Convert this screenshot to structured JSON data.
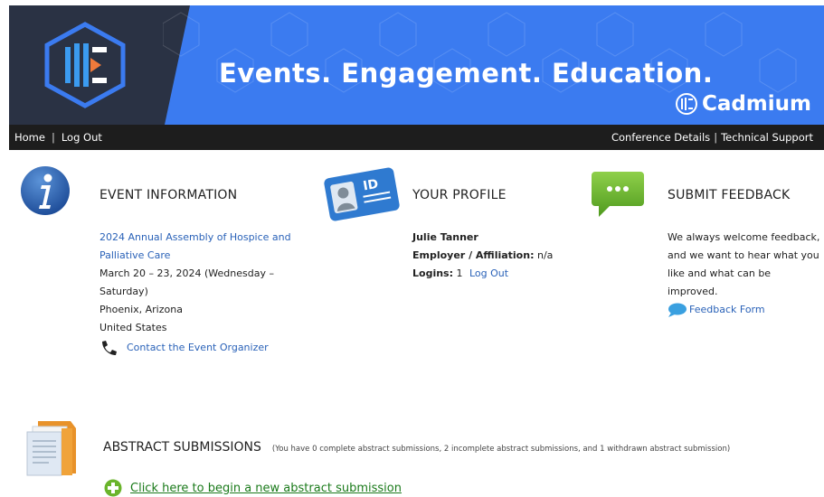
{
  "banner": {
    "tagline": "Events.  Engagement.  Education.",
    "brand": "Cadmium",
    "colors": {
      "blue": "#3b7bf0",
      "dark": "#2a3244"
    }
  },
  "nav": {
    "left": [
      "Home",
      "Log Out"
    ],
    "right": [
      "Conference Details",
      "Technical Support"
    ]
  },
  "event": {
    "title": "EVENT INFORMATION",
    "name_line1": "2024 Annual Assembly of Hospice and",
    "name_line2": "Palliative Care",
    "dates": "March 20 – 23, 2024 (Wednesday – Saturday)",
    "city": "Phoenix, Arizona",
    "country": "United States",
    "contact": "Contact the Event Organizer"
  },
  "profile": {
    "title": "YOUR PROFILE",
    "name": "Julie Tanner",
    "employer_label": "Employer / Affiliation:",
    "employer_value": "n/a",
    "logins_label": "Logins:",
    "logins_value": "1",
    "logout": "Log Out"
  },
  "feedback": {
    "title": "SUBMIT FEEDBACK",
    "line1": "We always welcome feedback,",
    "line2": "and we want to hear what you",
    "line3": "like and what can be improved.",
    "link": "Feedback Form"
  },
  "abstracts": {
    "title": "ABSTRACT SUBMISSIONS",
    "note": "(You have 0 complete abstract submissions, 2 incomplete abstract submissions, and 1 withdrawn abstract submission)",
    "new_link": "Click here to begin a new abstract submission"
  },
  "icons": [
    "logo-icon",
    "info-icon",
    "id-card-icon",
    "chat-bubble-icon",
    "phone-icon",
    "speech-icon",
    "folder-icon",
    "plus-icon",
    "cadmium-icon"
  ]
}
